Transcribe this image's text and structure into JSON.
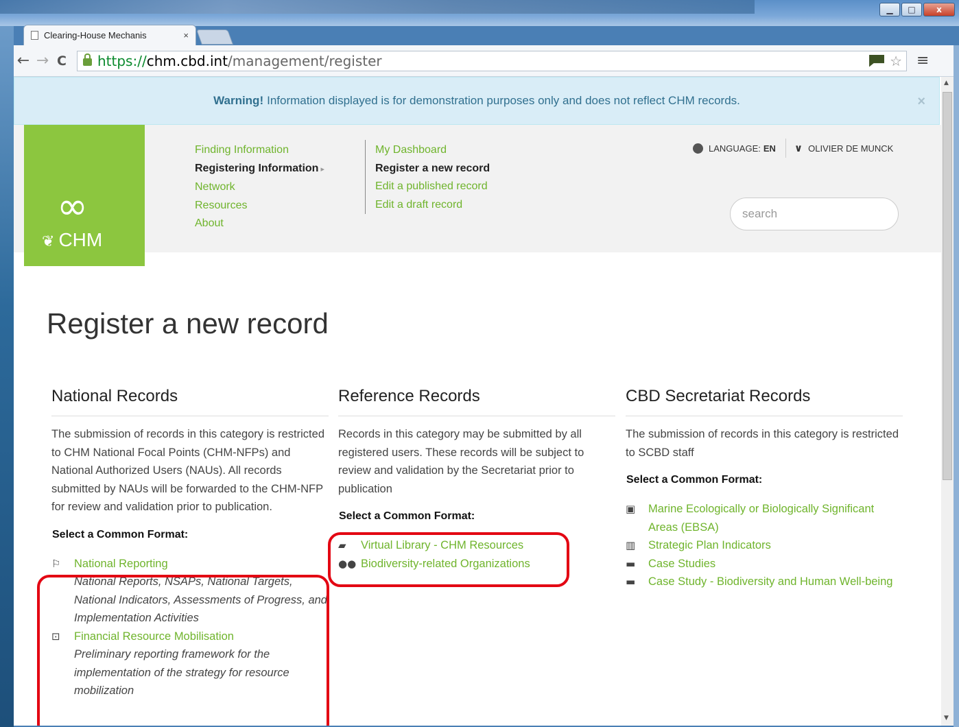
{
  "browser": {
    "tab_title": "Clearing-House Mechanis",
    "tab_close": "×",
    "url_scheme": "https://",
    "url_host": "chm.cbd.int",
    "url_path": "/management/register",
    "back": "←",
    "forward": "→",
    "reload": "C",
    "star": "☆",
    "menu": "≡",
    "window_min": "▁",
    "window_max": "□",
    "window_close": "x"
  },
  "alert": {
    "strong": "Warning!",
    "text": "Information displayed is for demonstration purposes only and does not reflect CHM records.",
    "close": "×"
  },
  "logo": {
    "text": "CHM"
  },
  "nav": {
    "items": [
      "Finding Information",
      "Registering Information",
      "Network",
      "Resources",
      "About"
    ],
    "sub": [
      "My Dashboard",
      "Register a new record",
      "Edit a published record",
      "Edit a draft record"
    ]
  },
  "user": {
    "language_label": "LANGUAGE:",
    "language_code": "EN",
    "name": "OLIVIER DE MUNCK"
  },
  "search": {
    "placeholder": "search"
  },
  "page": {
    "title": "Register a new record"
  },
  "columns": [
    {
      "title": "National Records",
      "text": "The submission of records in this category is restricted to CHM National Focal Points (CHM-NFPs) and National Authorized Users (NAUs). All records submitted by NAUs will be forwarded to the CHM-NFP for review and validation prior to publication.",
      "select_label": "Select a Common Format:",
      "formats": [
        {
          "label": "National Reporting",
          "desc": "National Reports, NSAPs, National Targets, National Indicators, Assessments of Progress, and Implementation Activities",
          "icon": "flag-icon"
        },
        {
          "label": "Financial Resource Mobilisation",
          "desc": "Preliminary reporting framework for the implementation of the strategy for resource mobilization",
          "icon": "money-icon"
        }
      ]
    },
    {
      "title": "Reference Records",
      "text": "Records in this category may be submitted by all registered users. These records will be subject to review and validation by the Secretariat prior to publication",
      "select_label": "Select a Common Format:",
      "formats": [
        {
          "label": "Virtual Library - CHM Resources",
          "icon": "book-icon"
        },
        {
          "label": "Biodiversity-related Organizations",
          "icon": "users-icon"
        }
      ]
    },
    {
      "title": "CBD Secretariat Records",
      "text": "The submission of records in this category is restricted to SCBD staff",
      "select_label": "Select a Common Format:",
      "formats": [
        {
          "label": "Marine Ecologically or Biologically Significant Areas (EBSA)",
          "icon": "picture-icon"
        },
        {
          "label": "Strategic Plan Indicators",
          "icon": "bar-chart-icon"
        },
        {
          "label": "Case Studies",
          "icon": "folder-open-icon"
        },
        {
          "label": "Case Study - Biodiversity and Human Well-being",
          "icon": "folder-open-icon"
        }
      ]
    }
  ]
}
